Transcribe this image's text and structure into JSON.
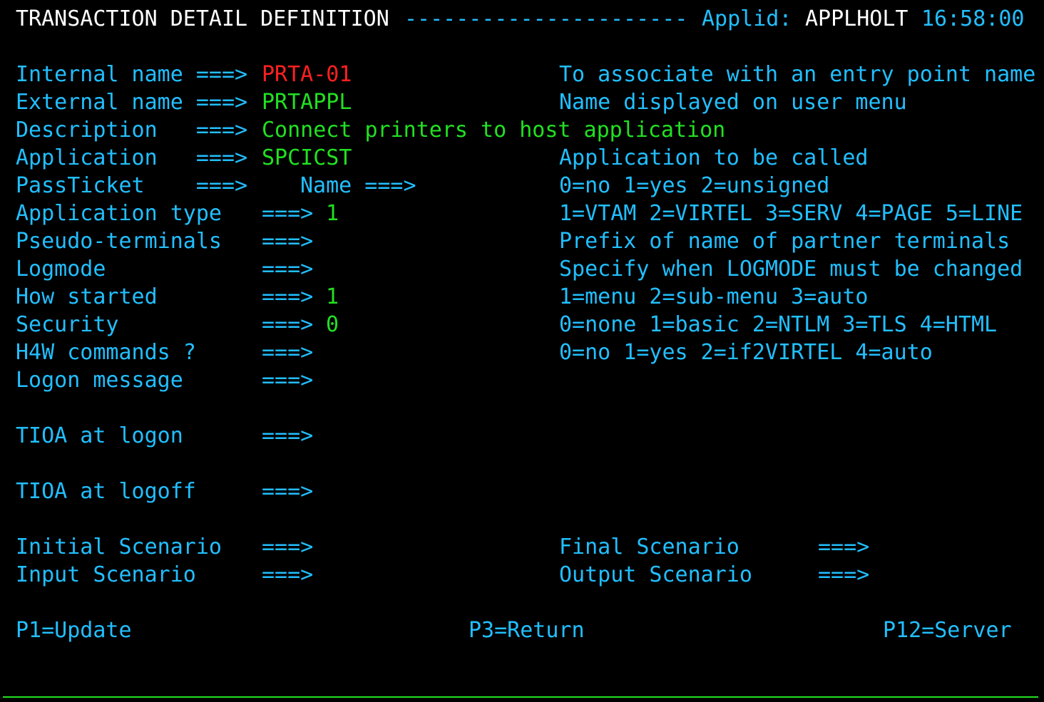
{
  "header": {
    "title": "TRANSACTION DETAIL DEFINITION",
    "dashes": "----------------------",
    "applid_label": "Applid:",
    "applid_value": "APPLHOLT",
    "time": "16:58:00"
  },
  "fields": {
    "internal_name": {
      "label": "Internal name ===>",
      "value": "PRTA-01",
      "help": "To associate with an entry point name"
    },
    "external_name": {
      "label": "External name ===>",
      "value": "PRTAPPL",
      "help": "Name displayed on user menu"
    },
    "description": {
      "label": "Description   ===>",
      "value": "Connect printers to host application"
    },
    "application": {
      "label": "Application   ===>",
      "value": "SPCICST",
      "help": "Application to be called"
    },
    "passticket": {
      "label": "PassTicket    ===>",
      "name_label": "Name ===>",
      "value": "",
      "name_value": "",
      "help": "0=no 1=yes 2=unsigned"
    },
    "application_type": {
      "label": "Application type",
      "arrow": "===>",
      "value": "1",
      "help": "1=VTAM 2=VIRTEL 3=SERV 4=PAGE 5=LINE"
    },
    "pseudo_terminals": {
      "label": "Pseudo-terminals",
      "arrow": "===>",
      "value": "",
      "help": "Prefix of name of partner terminals"
    },
    "logmode": {
      "label": "Logmode",
      "arrow": "===>",
      "value": "",
      "help": "Specify when LOGMODE must be changed"
    },
    "how_started": {
      "label": "How started",
      "arrow": "===>",
      "value": "1",
      "help": "1=menu 2=sub-menu 3=auto"
    },
    "security": {
      "label": "Security",
      "arrow": "===>",
      "value": "0",
      "help": "0=none 1=basic 2=NTLM 3=TLS 4=HTML"
    },
    "h4w_commands": {
      "label": "H4W commands ?",
      "arrow": "===>",
      "value": "",
      "help": "0=no 1=yes 2=if2VIRTEL 4=auto"
    },
    "logon_message": {
      "label": "Logon message",
      "arrow": "===>",
      "value": ""
    },
    "tioa_logon": {
      "label": "TIOA at logon",
      "arrow": "===>",
      "value": ""
    },
    "tioa_logoff": {
      "label": "TIOA at logoff",
      "arrow": "===>",
      "value": ""
    },
    "initial_scenario": {
      "label": "Initial Scenario",
      "arrow": "===>",
      "value": ""
    },
    "final_scenario": {
      "label": "Final Scenario",
      "arrow": "===>",
      "value": ""
    },
    "input_scenario": {
      "label": "Input Scenario",
      "arrow": "===>",
      "value": ""
    },
    "output_scenario": {
      "label": "Output Scenario",
      "arrow": "===>",
      "value": ""
    }
  },
  "function_keys": {
    "p1": "P1=Update",
    "p3": "P3=Return",
    "p12": "P12=Server"
  },
  "colors": {
    "background": "#000000",
    "label": "#22bfff",
    "title": "#ffffff",
    "value": "#22e022",
    "error_value": "#ff2020"
  }
}
